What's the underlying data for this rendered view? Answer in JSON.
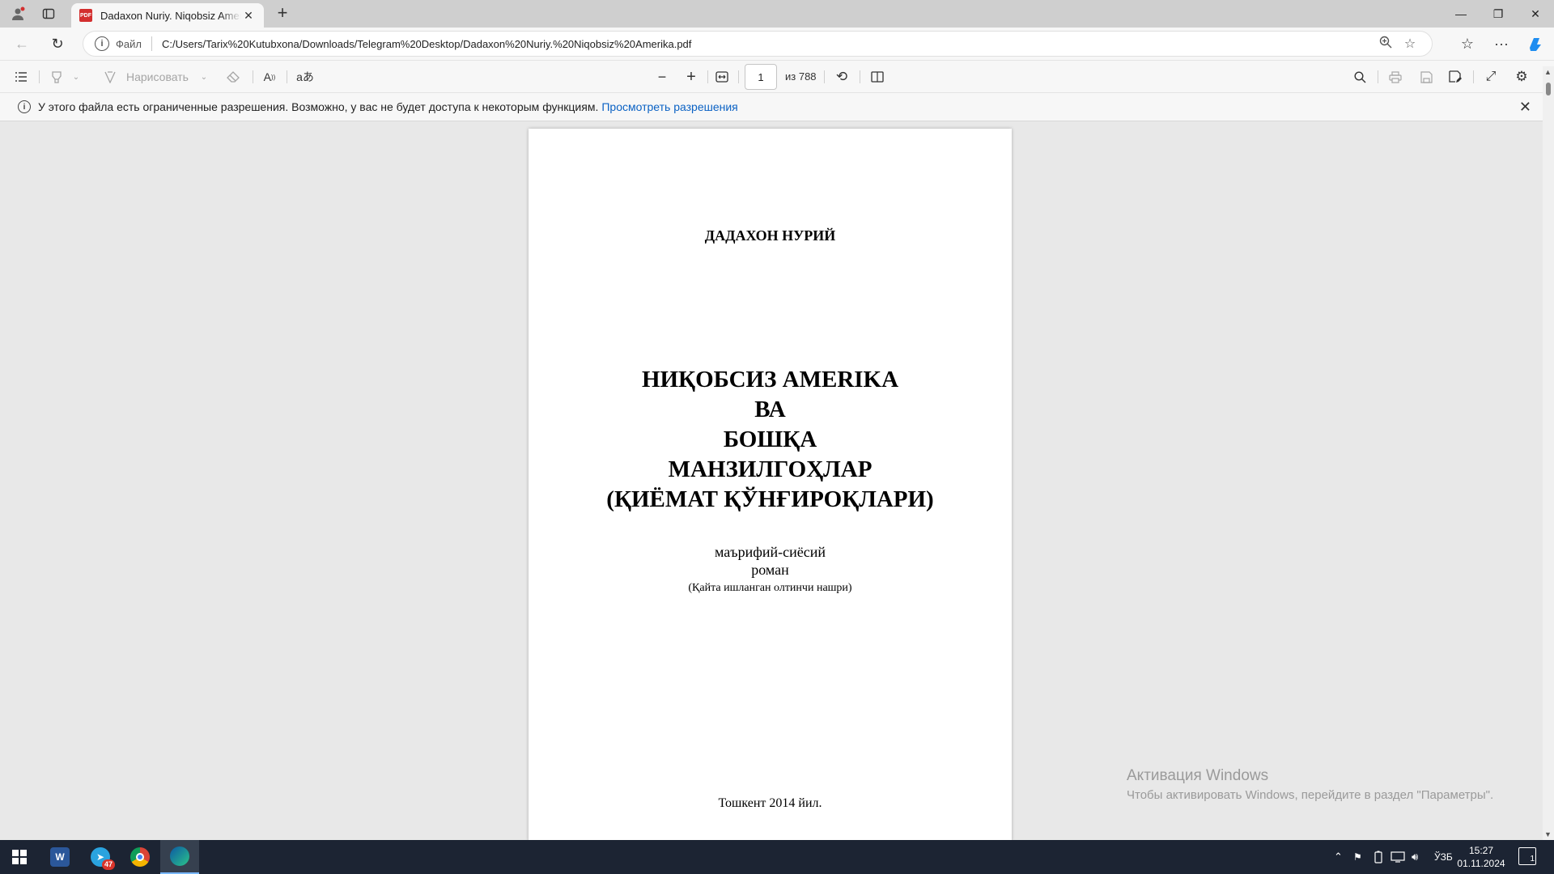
{
  "browser": {
    "tab_title": "Dadaxon Nuriy. Niqobsiz Amerika.pdf",
    "tab_favicon": "PDF",
    "address_scheme": "Файл",
    "address_url": "C:/Users/Tarix%20Kutubxona/Downloads/Telegram%20Desktop/Dadaxon%20Nuriy.%20Niqobsiz%20Amerika.pdf"
  },
  "pdf_toolbar": {
    "draw_label": "Нарисовать",
    "page_current": "1",
    "page_total": "из 788"
  },
  "infobar": {
    "message": "У этого файла есть ограниченные разрешения. Возможно, у вас не будет доступа к некоторым функциям.",
    "link": "Просмотреть разрешения"
  },
  "document": {
    "author": "ДАДАХОН НУРИЙ",
    "title_lines": [
      "НИҚОБСИЗ AMERIKA",
      "ВА",
      "БОШҚА",
      "МАНЗИЛГОҲЛАР",
      "(ҚИЁМАТ ҚЎНҒИРОҚЛАРИ)"
    ],
    "subtitle_lines": [
      "маърифий-сиёсий",
      "роман"
    ],
    "edition": "(Қайта ишланган олтинчи нашри)",
    "city_year": "Тошкент 2014 йил."
  },
  "watermark": {
    "title": "Активация Windows",
    "subtitle": "Чтобы активировать Windows, перейдите в раздел \"Параметры\"."
  },
  "taskbar": {
    "telegram_badge": "47",
    "language": "ЎЗБ",
    "time": "15:27",
    "date": "01.11.2024",
    "notification_count": "1"
  },
  "colors": {
    "link": "#0b62c4",
    "taskbar": "#1c2433",
    "pdf_icon": "#d32f2f"
  }
}
